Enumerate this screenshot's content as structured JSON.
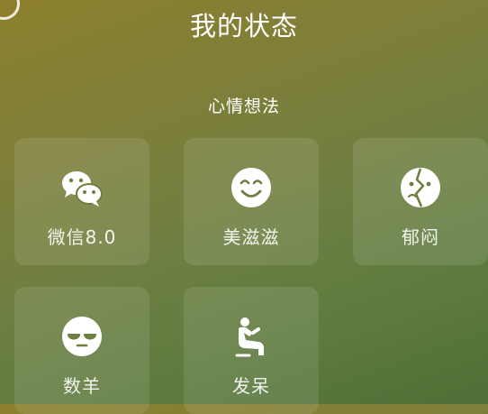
{
  "page": {
    "title": "我的状态"
  },
  "section": {
    "title": "心情想法"
  },
  "tiles": [
    {
      "label": "微信8.0",
      "icon": "wechat-icon"
    },
    {
      "label": "美滋滋",
      "icon": "smile-face-icon"
    },
    {
      "label": "郁闷",
      "icon": "broken-heart-icon"
    },
    {
      "label": "数羊",
      "icon": "sleepy-face-icon"
    },
    {
      "label": "发呆",
      "icon": "daze-figure-icon"
    }
  ],
  "colors": {
    "background_top": "#8c7f2c",
    "background_bottom": "#4f6f36",
    "tile_background": "rgba(255,255,255,0.10)",
    "text": "#ffffff"
  }
}
